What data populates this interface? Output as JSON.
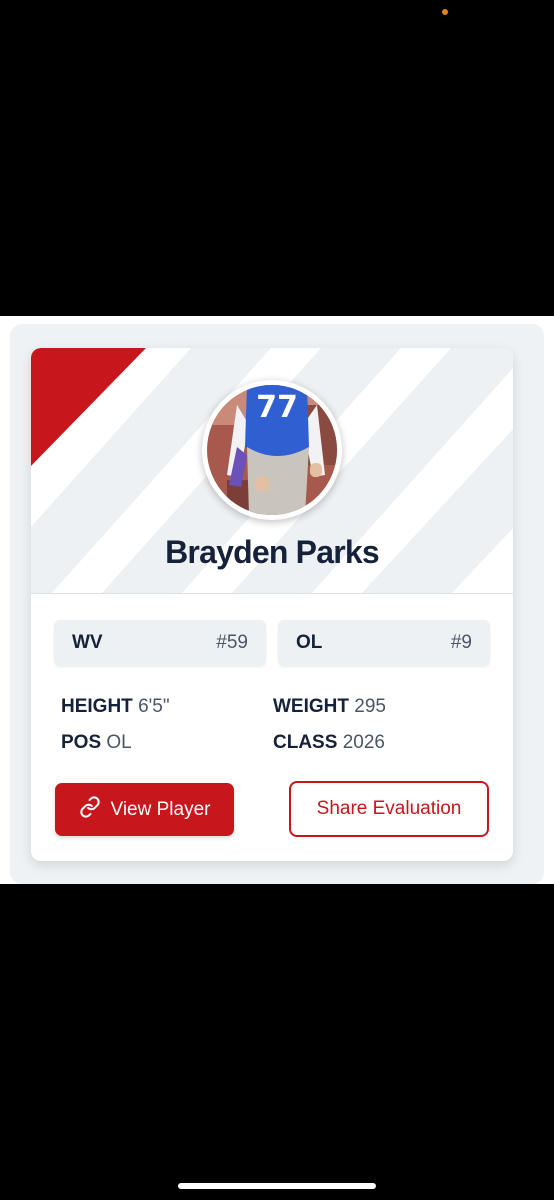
{
  "player": {
    "name": "Brayden Parks",
    "jersey_number": "77"
  },
  "tags": [
    {
      "code": "WV",
      "number": "#59"
    },
    {
      "code": "OL",
      "number": "#9"
    }
  ],
  "stats": {
    "height_label": "HEIGHT",
    "height_value": "6'5\"",
    "weight_label": "WEIGHT",
    "weight_value": "295",
    "pos_label": "POS",
    "pos_value": "OL",
    "class_label": "CLASS",
    "class_value": "2026"
  },
  "actions": {
    "view_player": "View Player",
    "share_evaluation": "Share Evaluation"
  },
  "icons": {
    "view_player_icon": "link-icon"
  },
  "colors": {
    "accent": "#c8161d",
    "text_dark": "#16213a",
    "text_muted": "#4a5566"
  }
}
